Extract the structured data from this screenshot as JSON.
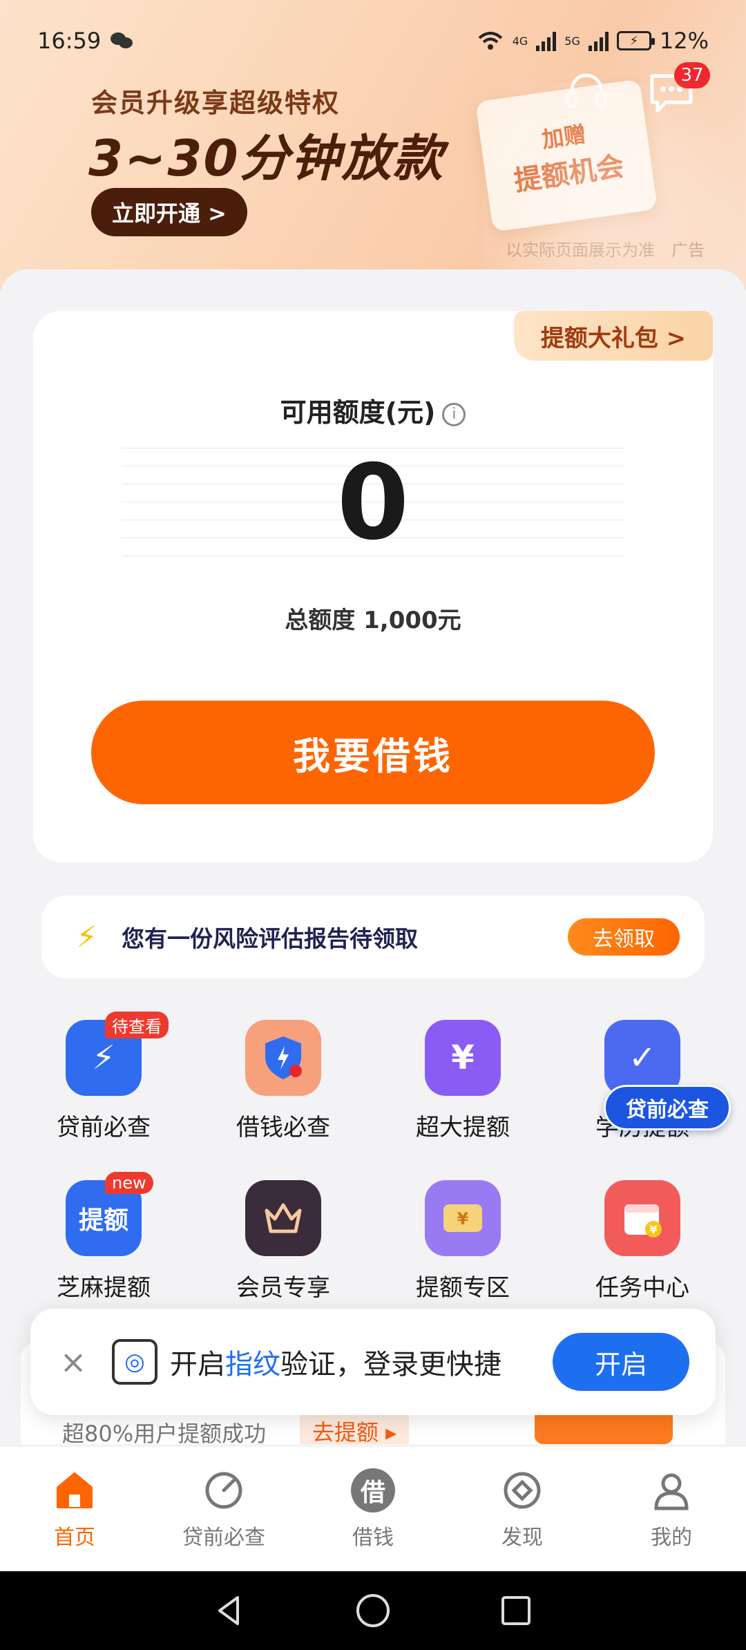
{
  "status": {
    "time": "16:59",
    "net1": "4G",
    "net2": "5G",
    "battery": "12%"
  },
  "banner": {
    "subtitle": "会员升级享超级特权",
    "title": "3~30分钟放款",
    "cta": "立即开通 >",
    "card_line1": "加赠",
    "card_line2": "提额机会",
    "disclaimer": "以实际页面展示为准",
    "ad_label": "广告",
    "message_count": "37"
  },
  "credit": {
    "gift_tag": "提额大礼包 >",
    "label": "可用额度(元)",
    "info": "i",
    "available": "0",
    "total": "总额度 1,000元",
    "borrow_button": "我要借钱"
  },
  "risk": {
    "text": "您有一份风险评估报告待领取",
    "button": "去领取"
  },
  "services": [
    {
      "label": "贷前必查",
      "tag": "待查看",
      "color": "#2f6cf0",
      "icon": "shield-bolt-icon"
    },
    {
      "label": "借钱必查",
      "tag": "",
      "color": "#f6a07c",
      "icon": "shield-alert-icon"
    },
    {
      "label": "超大提额",
      "tag": "",
      "color": "#8a5cf6",
      "icon": "gift-box-icon"
    },
    {
      "label": "学历提额",
      "tag": "",
      "color": "#4b6af0",
      "icon": "phone-check-icon"
    },
    {
      "label": "芝麻提额",
      "tag": "new",
      "color": "#2f6cf0",
      "icon": "raise-limit-icon",
      "glyph": "提额"
    },
    {
      "label": "会员专享",
      "tag": "",
      "color": "#3a2c3a",
      "icon": "crown-icon"
    },
    {
      "label": "提额专区",
      "tag": "",
      "color": "#9a7af2",
      "icon": "wallet-icon"
    },
    {
      "label": "任务中心",
      "tag": "",
      "color": "#f35b5b",
      "icon": "calendar-icon"
    }
  ],
  "float_badge": "贷前必查",
  "promo": {
    "text": "超80%用户提额成功",
    "button": "去提额 ▸"
  },
  "toast": {
    "msg_before": "开启",
    "msg_highlight": "指纹",
    "msg_after": "验证，登录更快捷",
    "button": "开启"
  },
  "tabs": [
    {
      "label": "首页",
      "active": true
    },
    {
      "label": "贷前必查",
      "active": false
    },
    {
      "label": "借钱",
      "active": false,
      "glyph": "借"
    },
    {
      "label": "发现",
      "active": false
    },
    {
      "label": "我的",
      "active": false
    }
  ],
  "colors": {
    "accent": "#fd6503",
    "blue": "#1e6ff0",
    "gold_tag": "#fbd3a6"
  }
}
